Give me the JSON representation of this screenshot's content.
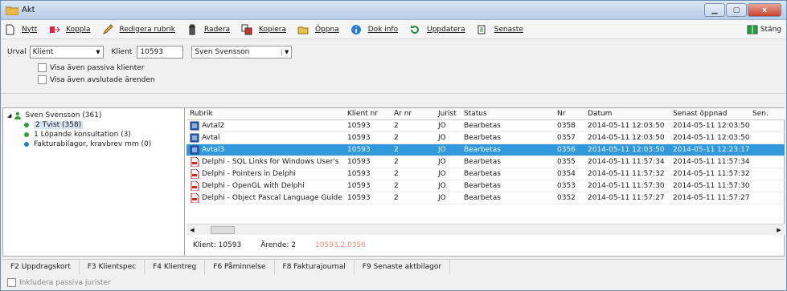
{
  "window": {
    "title": "Akt",
    "controls": [
      "minimize",
      "maximize",
      "close"
    ],
    "close_glyph": "x"
  },
  "toolbar": {
    "buttons": [
      {
        "label": "Nytt",
        "icon": "new-document-icon"
      },
      {
        "label": "Koppla",
        "icon": "link-icon"
      },
      {
        "label": "Redigera rubrik",
        "icon": "edit-pencil-icon"
      },
      {
        "label": "Radera",
        "icon": "trash-icon"
      },
      {
        "label": "Kopiera",
        "icon": "copy-icon"
      },
      {
        "label": "Öppna",
        "icon": "open-folder-icon"
      },
      {
        "label": "Dok info",
        "icon": "info-icon"
      },
      {
        "label": "Uppdatera",
        "icon": "refresh-icon"
      },
      {
        "label": "Senaste",
        "icon": "recent-icon"
      }
    ],
    "close_label": "Stäng"
  },
  "filter": {
    "urval_label": "Urval",
    "urval_value": "Klient",
    "klient_label": "Klient",
    "klient_value": "10593",
    "client_name": "Sven Svensson",
    "check_passiva": "Visa även passiva klienter",
    "check_avslutade": "Visa även avslutade ärenden"
  },
  "tree": {
    "root": "Sven Svensson (361)",
    "children": [
      {
        "label": "2 Tvist (358)",
        "color": "#2e9e3a"
      },
      {
        "label": "1 Löpande konsultation (3)",
        "color": "#2e9e3a"
      },
      {
        "label": "Fakturabilagor, kravbrev mm (0)",
        "color": "#1e7fd6"
      }
    ]
  },
  "grid": {
    "headers": [
      "Rubrik",
      "Klient nr",
      "År nr",
      "Jurist",
      "Status",
      "Nr",
      "Datum",
      "Senast öppnad",
      "Sen."
    ],
    "rows": [
      {
        "rubrik": "Avtal2",
        "klient": "10593",
        "ar": "2",
        "jurist": "JO",
        "status": "Bearbetas",
        "nr": "0358",
        "datum": "2014-05-11 12:03:50",
        "senast": "2014-05-11 12:03:50",
        "type": "word",
        "selected": false
      },
      {
        "rubrik": "Avtal",
        "klient": "10593",
        "ar": "2",
        "jurist": "JO",
        "status": "Bearbetas",
        "nr": "0357",
        "datum": "2014-05-11 12:03:50",
        "senast": "2014-05-11 12:03:50",
        "type": "word",
        "selected": false
      },
      {
        "rubrik": "Avtal3",
        "klient": "10593",
        "ar": "2",
        "jurist": "JO",
        "status": "Bearbetas",
        "nr": "0356",
        "datum": "2014-05-11 12:03:50",
        "senast": "2014-05-11 12:23:17",
        "type": "word",
        "selected": true
      },
      {
        "rubrik": "Delphi - SQL Links for Windows User's",
        "klient": "10593",
        "ar": "2",
        "jurist": "JO",
        "status": "Bearbetas",
        "nr": "0355",
        "datum": "2014-05-11 11:57:34",
        "senast": "2014-05-11 11:57:34",
        "type": "pdf",
        "selected": false
      },
      {
        "rubrik": "Delphi - Pointers in Delphi",
        "klient": "10593",
        "ar": "2",
        "jurist": "JO",
        "status": "Bearbetas",
        "nr": "0354",
        "datum": "2014-05-11 11:57:32",
        "senast": "2014-05-11 11:57:32",
        "type": "pdf",
        "selected": false
      },
      {
        "rubrik": "Delphi - OpenGL with Delphi",
        "klient": "10593",
        "ar": "2",
        "jurist": "JO",
        "status": "Bearbetas",
        "nr": "0353",
        "datum": "2014-05-11 11:57:30",
        "senast": "2014-05-11 11:57:30",
        "type": "pdf",
        "selected": false
      },
      {
        "rubrik": "Delphi - Object Pascal Language Guide",
        "klient": "10593",
        "ar": "2",
        "jurist": "JO",
        "status": "Bearbetas",
        "nr": "0352",
        "datum": "2014-05-11 11:57:27",
        "senast": "2014-05-11 11:57:27",
        "type": "pdf",
        "selected": false
      }
    ]
  },
  "status_strip": {
    "klient": "Klient: 10593",
    "arende": "Ärende: 2",
    "ref": "10593.2.0356"
  },
  "fkeys": [
    "F2 Uppdragskort",
    "F3 Klientspec",
    "F4 Klientreg",
    "F6 Påminnelse",
    "F8 Fakturajournal",
    "F9 Senaste aktbilagor"
  ],
  "footer": {
    "check_label": "Inkludera passiva jurister"
  }
}
